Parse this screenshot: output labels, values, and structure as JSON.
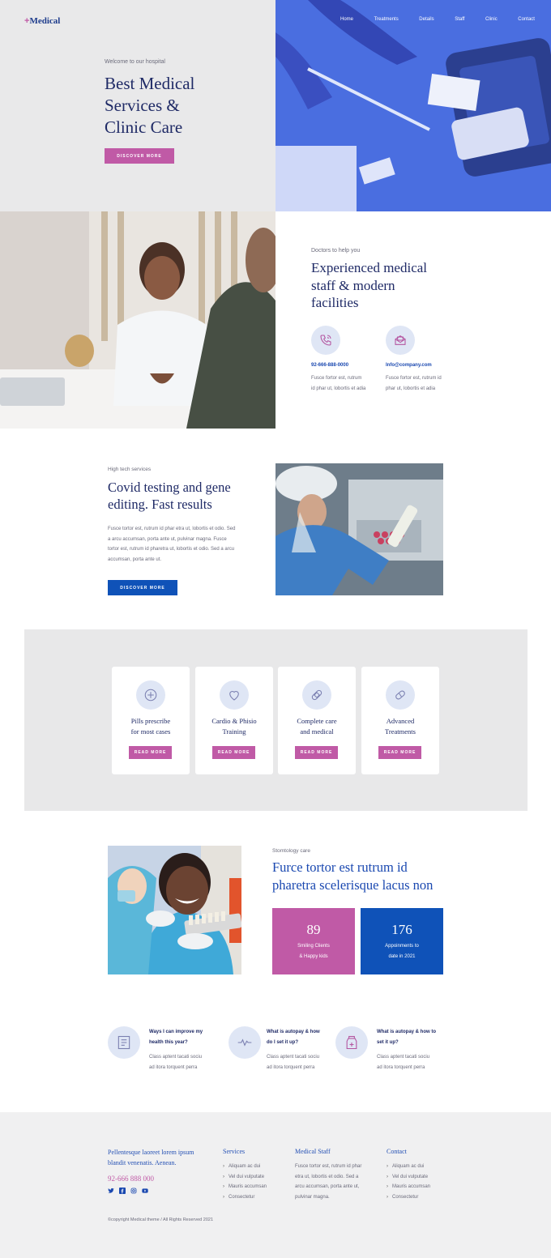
{
  "brand": {
    "name": "Medical",
    "plus": "+",
    "accent": "#c05aa6",
    "primary": "#0f52b8"
  },
  "nav": {
    "items": [
      "Home",
      "Treatments",
      "Details",
      "Staff",
      "Clinic",
      "Contact"
    ]
  },
  "hero": {
    "eyebrow": "Welcome to our hospital",
    "title_lines": [
      "Best Medical",
      "Services &",
      "Clinic Care"
    ],
    "button": "DISCOVER MORE"
  },
  "doctors": {
    "eyebrow": "Doctors to help you",
    "title_lines": [
      "Experienced medical",
      "staff & modern",
      "facilities"
    ],
    "contacts": [
      {
        "icon": "phone-icon",
        "value": "92-666-888-0000",
        "text": [
          "Fusce fortor est, rutrum",
          "id phar ut, lobortis et adia"
        ]
      },
      {
        "icon": "mail-icon",
        "value": "Info@company.com",
        "text": [
          "Fusce fortor est, rutrum id",
          "phar ut, lobortis et adia"
        ]
      }
    ]
  },
  "covid": {
    "eyebrow": "High tech services",
    "title_lines": [
      "Covid testing and gene",
      "editing. Fast results"
    ],
    "para_lines": [
      "Fusce tortor est, rutrum id phar etra ut, lobortis et odio. Sed",
      "a arcu accumsan, porta ante ut, pulvinar magna. Fusce",
      "tortor est, rutrum id pharetra ut, lobortis et odio. Sed a arcu",
      "accumsan, porta ante ut."
    ],
    "button": "DISCOVER MORE"
  },
  "services": {
    "cards": [
      {
        "icon": "plus-circle-icon",
        "title": [
          "Pills prescribe",
          "for most cases"
        ],
        "button": "READ MORE"
      },
      {
        "icon": "heart-icon",
        "title": [
          "Cardio & Phisio",
          "Training"
        ],
        "button": "READ MORE"
      },
      {
        "icon": "bandage-icon",
        "title": [
          "Complete care",
          "and medical"
        ],
        "button": "READ MORE"
      },
      {
        "icon": "pill-icon",
        "title": [
          "Advanced",
          "Treatments"
        ],
        "button": "READ MORE"
      }
    ]
  },
  "dental": {
    "eyebrow": "Stomtology care",
    "title_lines": [
      "Furce tortor est rutrum id",
      "pharetra scelerisque lacus non"
    ],
    "stats": [
      {
        "number": "89",
        "label": [
          "Smiling Clients",
          "& Happy kids"
        ],
        "color": "#c05aa6"
      },
      {
        "number": "176",
        "label": [
          "Appoinments to",
          "date in 2021"
        ],
        "color": "#0f52b8"
      }
    ]
  },
  "faq": [
    {
      "icon": "document-icon",
      "title": [
        "Ways I can improve my",
        "health this year?"
      ],
      "text": [
        "Class aptent tacati sociu",
        "ad itora torquent perra"
      ]
    },
    {
      "icon": "pulse-icon",
      "title": [
        "What is autopay & how",
        "do I set it up?"
      ],
      "text": [
        "Class aptent tacati sociu",
        "ad itora torquent perra"
      ]
    },
    {
      "icon": "medicine-bottle-icon",
      "title": [
        "What is autopay & how to",
        "set it up?"
      ],
      "text": [
        "Class aptent tacati sociu",
        "ad itora torquent perra"
      ]
    }
  ],
  "footer": {
    "tagline": [
      "Pellentesque laoreet lorem ipsum",
      "blandit venenatis. Aenean."
    ],
    "phone": "92-666 888 000",
    "social": [
      "twitter-icon",
      "facebook-icon",
      "instagram-icon",
      "youtube-icon"
    ],
    "services": {
      "title": "Services",
      "items": [
        "Aliquam ac dui",
        "Vel dui vulputate",
        "Mauris accumsan",
        "Consectetur"
      ]
    },
    "staff": {
      "title": "Medical Staff",
      "lines": [
        "Fusce tortor est, rutrum id phar",
        "etra ut, lobortis et odio. Sed a",
        "arcu accumsan, porta ante ut,",
        "pulvinar magna."
      ]
    },
    "contact": {
      "title": "Contact",
      "items": [
        "Aliquam ac dui",
        "Vel dui vulputate",
        "Mauris accumsan",
        "Consectetur"
      ]
    },
    "copyright": "©copyright Medical theme / All Rights Reserved 2021"
  }
}
